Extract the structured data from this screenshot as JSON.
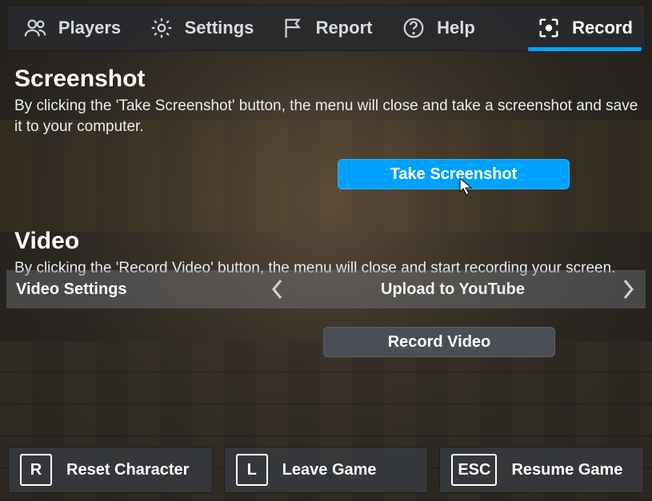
{
  "tabs": {
    "players": {
      "label": "Players"
    },
    "settings": {
      "label": "Settings"
    },
    "report": {
      "label": "Report"
    },
    "help": {
      "label": "Help"
    },
    "record": {
      "label": "Record",
      "active": true
    }
  },
  "screenshot": {
    "heading": "Screenshot",
    "desc": "By clicking the 'Take Screenshot' button, the menu will close and take a screenshot and save it to your computer.",
    "button": "Take Screenshot"
  },
  "video": {
    "heading": "Video",
    "desc": "By clicking the 'Record Video' button, the menu will close and start recording your screen.",
    "settings_label": "Video Settings",
    "settings_value": "Upload to YouTube",
    "button": "Record Video"
  },
  "footer": {
    "reset": {
      "key": "R",
      "label": "Reset Character"
    },
    "leave": {
      "key": "L",
      "label": "Leave Game"
    },
    "resume": {
      "key": "ESC",
      "label": "Resume Game"
    }
  },
  "colors": {
    "accent": "#00a2ff"
  }
}
